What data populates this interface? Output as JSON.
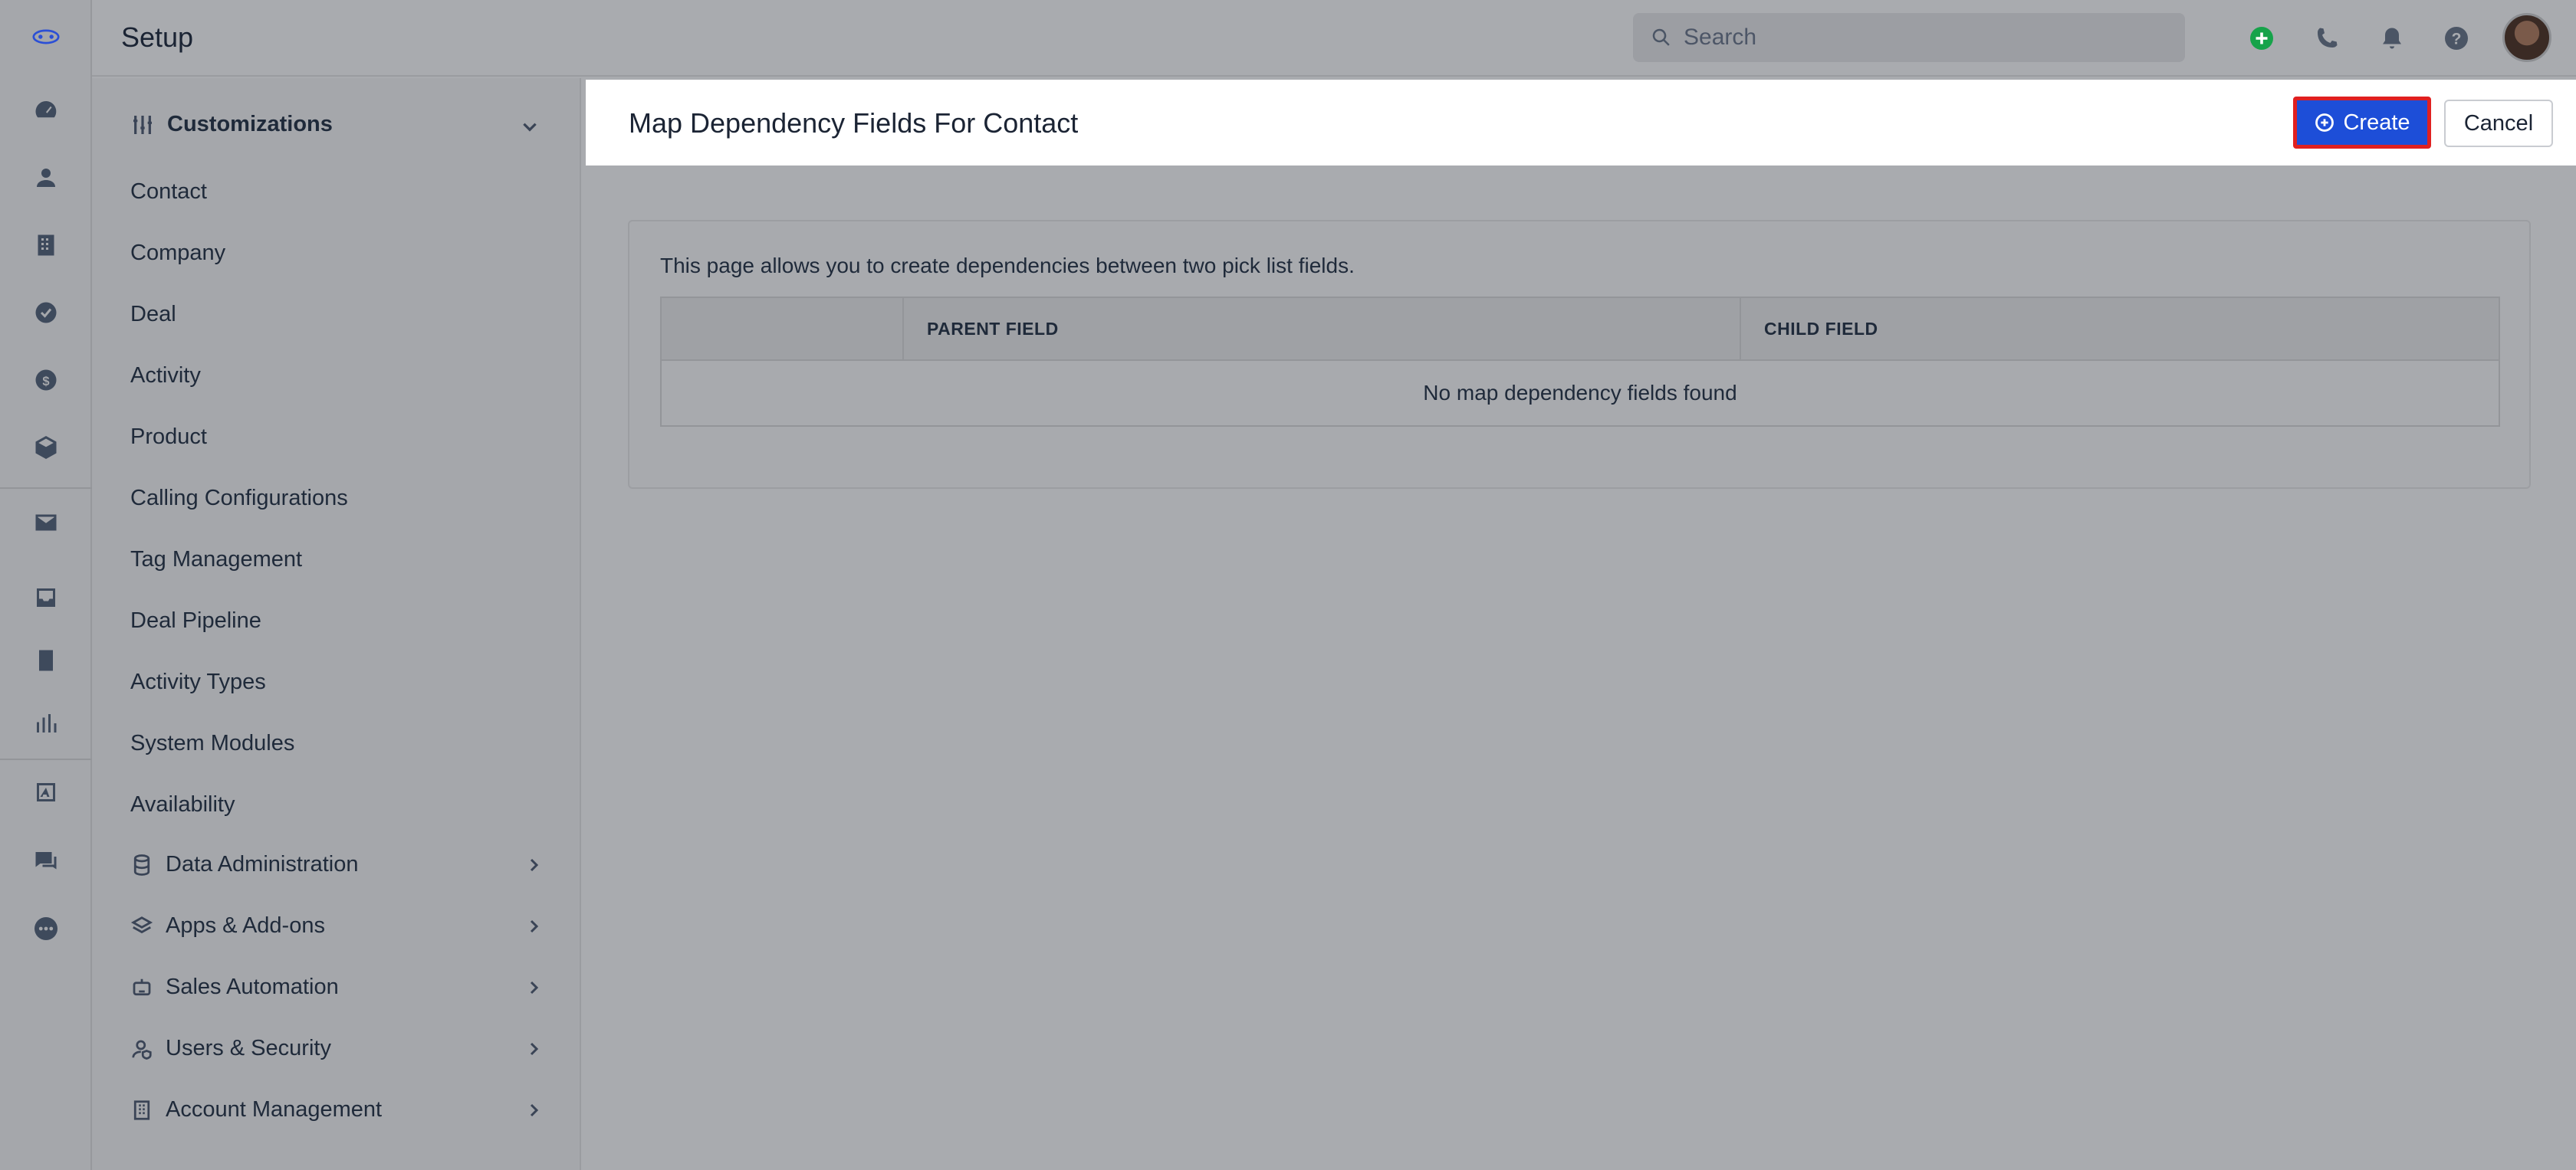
{
  "header": {
    "title": "Setup",
    "search_placeholder": "Search"
  },
  "sidebar": {
    "section_title": "Customizations",
    "items": [
      {
        "label": "Contact"
      },
      {
        "label": "Company"
      },
      {
        "label": "Deal"
      },
      {
        "label": "Activity"
      },
      {
        "label": "Product"
      },
      {
        "label": "Calling Configurations"
      },
      {
        "label": "Tag Management"
      },
      {
        "label": "Deal Pipeline"
      },
      {
        "label": "Activity Types"
      },
      {
        "label": "System Modules"
      },
      {
        "label": "Availability"
      }
    ],
    "groups": [
      {
        "label": "Data Administration",
        "icon": "database-icon"
      },
      {
        "label": "Apps & Add-ons",
        "icon": "layers-icon"
      },
      {
        "label": "Sales Automation",
        "icon": "robot-icon"
      },
      {
        "label": "Users & Security",
        "icon": "user-shield-icon"
      },
      {
        "label": "Account Management",
        "icon": "building-icon"
      }
    ]
  },
  "page": {
    "title": "Map Dependency Fields For Contact",
    "create_label": "Create",
    "cancel_label": "Cancel",
    "description": "This page allows you to create dependencies between two pick list fields.",
    "table": {
      "columns": [
        "",
        "PARENT FIELD",
        "CHILD FIELD"
      ],
      "empty_message": "No map dependency fields found"
    }
  },
  "colors": {
    "primary": "#1d4ed8",
    "highlight_border": "#e02020",
    "add_icon": "#16a34a"
  }
}
